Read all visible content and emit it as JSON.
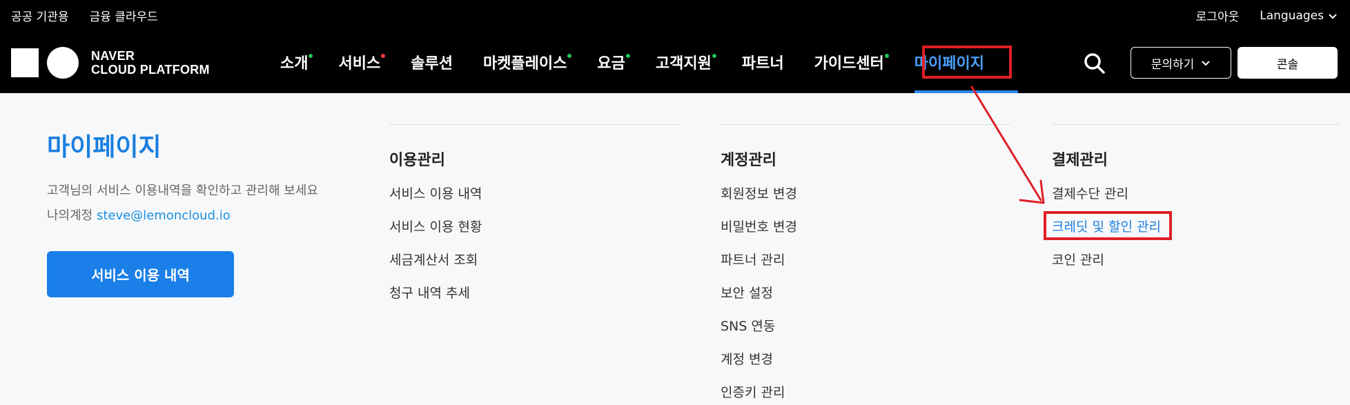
{
  "util": {
    "left": [
      "공공 기관용",
      "금융 클라우드"
    ],
    "logout": "로그아웃",
    "languages": "Languages"
  },
  "logo": {
    "line1": "NAVER",
    "line2": "CLOUD PLATFORM"
  },
  "nav": [
    {
      "label": "소개",
      "dot": "#21c35a"
    },
    {
      "label": "서비스",
      "dot": "#ff3b3b"
    },
    {
      "label": "솔루션",
      "dot": ""
    },
    {
      "label": "마켓플레이스",
      "dot": "#21c35a"
    },
    {
      "label": "요금",
      "dot": "#21c35a"
    },
    {
      "label": "고객지원",
      "dot": "#21c35a"
    },
    {
      "label": "파트너",
      "dot": ""
    },
    {
      "label": "가이드센터",
      "dot": "#21c35a"
    },
    {
      "label": "마이페이지",
      "dot": ""
    }
  ],
  "actions": {
    "inquiry": "문의하기",
    "console": "콘솔"
  },
  "mypage": {
    "title": "마이페이지",
    "desc": "고객님의 서비스 이용내역을 확인하고 관리해 보세요",
    "account_label": "나의계정",
    "email": "steve@lemoncloud.io",
    "button": "서비스 이용 내역"
  },
  "columns": [
    {
      "heading": "이용관리",
      "items": [
        "서비스 이용 내역",
        "서비스 이용 현황",
        "세금계산서 조회",
        "청구 내역 추세"
      ]
    },
    {
      "heading": "계정관리",
      "items": [
        "회원정보 변경",
        "비밀번호 변경",
        "파트너 관리",
        "보안 설정",
        "SNS 연동",
        "계정 변경",
        "인증키 관리"
      ]
    },
    {
      "heading": "결제관리",
      "items": [
        "결제수단 관리",
        "크레딧 및 할인 관리",
        "코인 관리"
      ]
    }
  ],
  "colors": {
    "accent": "#1a7fe0",
    "annotation": "#e01f26",
    "header_bg": "#000000"
  },
  "icons": {
    "search": "search-icon",
    "chevron": "chevron-down-icon"
  }
}
